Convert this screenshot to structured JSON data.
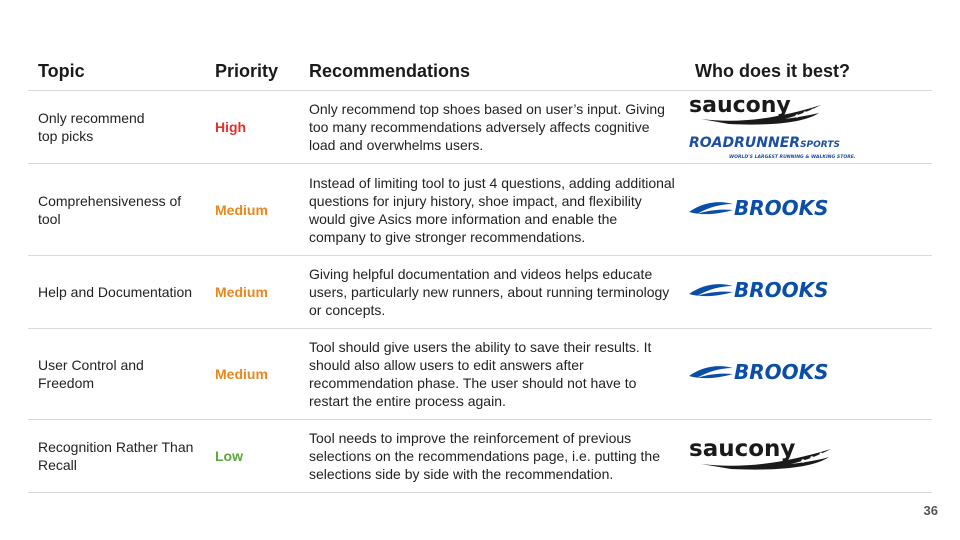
{
  "headers": {
    "topic": "Topic",
    "priority": "Priority",
    "recommendations": "Recommendations",
    "best": "Who does it best?"
  },
  "rows": [
    {
      "topic": "Only recommend\ntop picks",
      "priority": "High",
      "priority_color": "#e0322a",
      "recommendation": "Only recommend top shoes based on user’s input. Giving too many recommendations adversely affects cognitive load and overwhelms users.",
      "logos": [
        "saucony",
        "roadrunner-sports"
      ]
    },
    {
      "topic": "Comprehensiveness of tool",
      "priority": "Medium",
      "priority_color": "#e8871e",
      "recommendation": "Instead of limiting tool to just 4 questions, adding additional questions for injury history, shoe impact, and flexibility would give Asics more information and enable the company to give stronger recommendations.",
      "logos": [
        "brooks"
      ]
    },
    {
      "topic": "Help and Documentation",
      "priority": "Medium",
      "priority_color": "#e8871e",
      "recommendation": "Giving helpful documentation and videos helps educate users, particularly new runners, about running terminology or concepts.",
      "logos": [
        "brooks"
      ]
    },
    {
      "topic": "User Control and Freedom",
      "priority": "Medium",
      "priority_color": "#e8871e",
      "recommendation": "Tool should give users the ability to save their results. It should also allow users to edit answers after recommendation phase. The user should not have to restart the entire process again.",
      "logos": [
        "brooks"
      ]
    },
    {
      "topic": "Recognition Rather Than Recall",
      "priority": "Low",
      "priority_color": "#59a83a",
      "recommendation": "Tool needs to improve the reinforcement of previous selections on the recommendations page, i.e. putting the selections side by side with the recommendation.",
      "logos": [
        "saucony"
      ]
    }
  ],
  "logo_text": {
    "saucony": "saucony",
    "roadrunner_main": "ROADRUNNER",
    "roadrunner_sports": "SPORTS",
    "roadrunner_tagline": "WORLD'S LARGEST RUNNING & WALKING STORE.",
    "brooks": "BROOKS"
  },
  "colors": {
    "brooks_blue": "#0a4ea8",
    "roadrunner_blue": "#1c4fa1",
    "saucony_black": "#1a1a1a"
  },
  "page_number": "36"
}
